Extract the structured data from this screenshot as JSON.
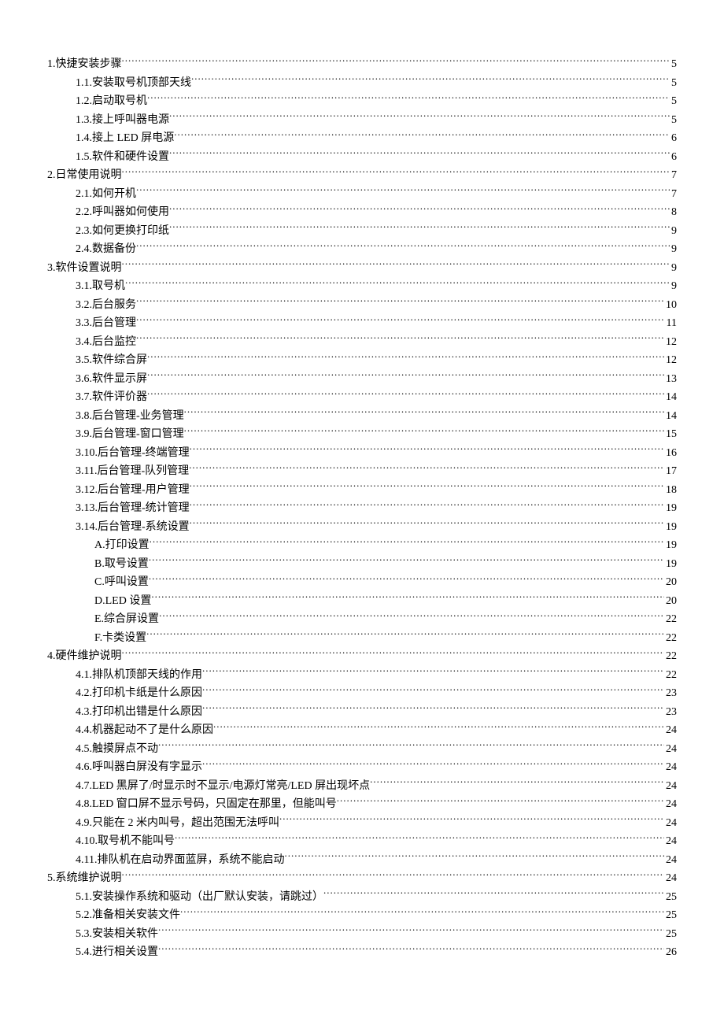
{
  "toc": [
    {
      "level": 1,
      "title": "1.快捷安装步骤",
      "page": "5"
    },
    {
      "level": 2,
      "title": "1.1.安装取号机顶部天线",
      "page": "5"
    },
    {
      "level": 2,
      "title": "1.2.启动取号机",
      "page": "5"
    },
    {
      "level": 2,
      "title": "1.3.接上呼叫器电源",
      "page": "5"
    },
    {
      "level": 2,
      "title": "1.4.接上 LED 屏电源",
      "page": "6"
    },
    {
      "level": 2,
      "title": "1.5.软件和硬件设置",
      "page": "6"
    },
    {
      "level": 1,
      "title": "2.日常使用说明",
      "page": "7"
    },
    {
      "level": 2,
      "title": "2.1.如何开机",
      "page": "7"
    },
    {
      "level": 2,
      "title": "2.2.呼叫器如何使用",
      "page": "8"
    },
    {
      "level": 2,
      "title": "2.3.如何更换打印纸",
      "page": "9"
    },
    {
      "level": 2,
      "title": "2.4.数据备份",
      "page": "9"
    },
    {
      "level": 1,
      "title": "3.软件设置说明",
      "page": "9"
    },
    {
      "level": 2,
      "title": "3.1.取号机",
      "page": "9"
    },
    {
      "level": 2,
      "title": "3.2.后台服务",
      "page": "10"
    },
    {
      "level": 2,
      "title": "3.3.后台管理",
      "page": "11"
    },
    {
      "level": 2,
      "title": "3.4.后台监控",
      "page": "12"
    },
    {
      "level": 2,
      "title": "3.5.软件综合屏",
      "page": "12"
    },
    {
      "level": 2,
      "title": "3.6.软件显示屏",
      "page": "13"
    },
    {
      "level": 2,
      "title": "3.7.软件评价器",
      "page": "14"
    },
    {
      "level": 2,
      "title": "3.8.后台管理-业务管理",
      "page": "14"
    },
    {
      "level": 2,
      "title": "3.9.后台管理-窗口管理",
      "page": "15"
    },
    {
      "level": 2,
      "title": "3.10.后台管理-终端管理",
      "page": "16"
    },
    {
      "level": 2,
      "title": "3.11.后台管理-队列管理",
      "page": "17"
    },
    {
      "level": 2,
      "title": "3.12.后台管理-用户管理",
      "page": "18"
    },
    {
      "level": 2,
      "title": "3.13.后台管理-统计管理",
      "page": "19"
    },
    {
      "level": 2,
      "title": "3.14.后台管理-系统设置",
      "page": "19"
    },
    {
      "level": 3,
      "title": "A.打印设置",
      "page": "19"
    },
    {
      "level": 3,
      "title": "B.取号设置",
      "page": "19"
    },
    {
      "level": 3,
      "title": "C.呼叫设置",
      "page": "20"
    },
    {
      "level": 3,
      "title": "D.LED 设置",
      "page": "20"
    },
    {
      "level": 3,
      "title": "E.综合屏设置",
      "page": "22"
    },
    {
      "level": 3,
      "title": "F.卡类设置",
      "page": "22"
    },
    {
      "level": 1,
      "title": "4.硬件维护说明",
      "page": "22"
    },
    {
      "level": 2,
      "title": "4.1.排队机顶部天线的作用",
      "page": "22"
    },
    {
      "level": 2,
      "title": "4.2.打印机卡纸是什么原因",
      "page": "23"
    },
    {
      "level": 2,
      "title": "4.3.打印机出错是什么原因",
      "page": "23"
    },
    {
      "level": 2,
      "title": "4.4.机器起动不了是什么原因",
      "page": "24"
    },
    {
      "level": 2,
      "title": "4.5.触摸屏点不动",
      "page": "24"
    },
    {
      "level": 2,
      "title": "4.6.呼叫器白屏没有字显示",
      "page": "24"
    },
    {
      "level": 2,
      "title": "4.7.LED 黑屏了/时显示时不显示/电源灯常亮/LED 屏出现坏点",
      "page": "24"
    },
    {
      "level": 2,
      "title": "4.8.LED 窗口屏不显示号码，只固定在那里，但能叫号",
      "page": "24"
    },
    {
      "level": 2,
      "title": "4.9.只能在 2 米内叫号，超出范围无法呼叫",
      "page": "24"
    },
    {
      "level": 2,
      "title": "4.10.取号机不能叫号",
      "page": "24"
    },
    {
      "level": 2,
      "title": "4.11.排队机在启动界面蓝屏，系统不能启动",
      "page": "24"
    },
    {
      "level": 1,
      "title": "5.系统维护说明",
      "page": "24"
    },
    {
      "level": 2,
      "title": "5.1.安装操作系统和驱动（出厂默认安装，请跳过）",
      "page": "25"
    },
    {
      "level": 2,
      "title": "5.2.准备相关安装文件",
      "page": "25"
    },
    {
      "level": 2,
      "title": "5.3.安装相关软件",
      "page": "25"
    },
    {
      "level": 2,
      "title": "5.4.进行相关设置",
      "page": "26"
    }
  ]
}
